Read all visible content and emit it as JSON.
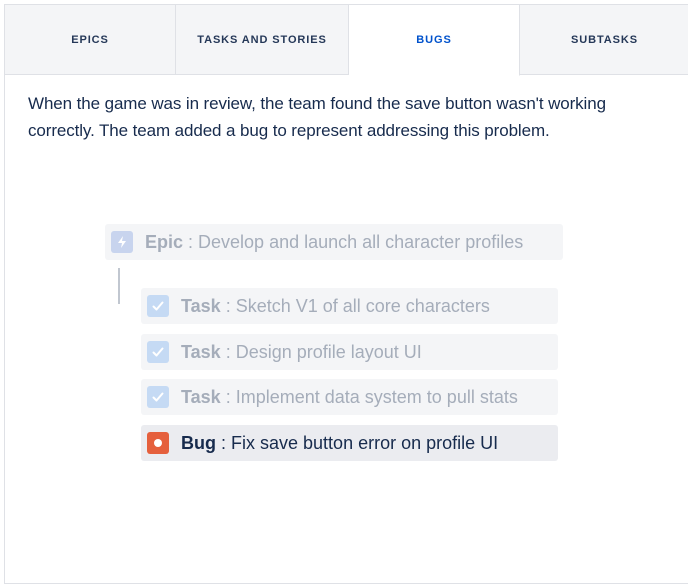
{
  "tabs": [
    {
      "label": "EPICS",
      "active": false
    },
    {
      "label": "TASKS AND STORIES",
      "active": false
    },
    {
      "label": "BUGS",
      "active": true
    },
    {
      "label": "SUBTASKS",
      "active": false
    }
  ],
  "description": "When the game was in review, the team found the save button wasn't working correctly. The team added a bug to represent addressing this problem.",
  "hierarchy": {
    "epic": {
      "type": "Epic",
      "separator": ":",
      "title": "Develop and launch all character profiles",
      "icon": "lightning-icon"
    },
    "items": [
      {
        "type": "Task",
        "separator": ":",
        "title": "Sketch V1 of all core characters",
        "icon": "checkbox-icon"
      },
      {
        "type": "Task",
        "separator": ":",
        "title": "Design profile layout UI",
        "icon": "checkbox-icon"
      },
      {
        "type": "Task",
        "separator": ":",
        "title": "Implement data system to pull stats",
        "icon": "checkbox-icon"
      },
      {
        "type": "Bug",
        "separator": ":",
        "title": "Fix save button error on profile UI",
        "icon": "bug-icon"
      }
    ]
  },
  "colors": {
    "active_tab_text": "#0052cc",
    "bug_icon": "#e5603d",
    "epic_icon": "#c8d4ee",
    "task_icon": "#c5daf4"
  }
}
